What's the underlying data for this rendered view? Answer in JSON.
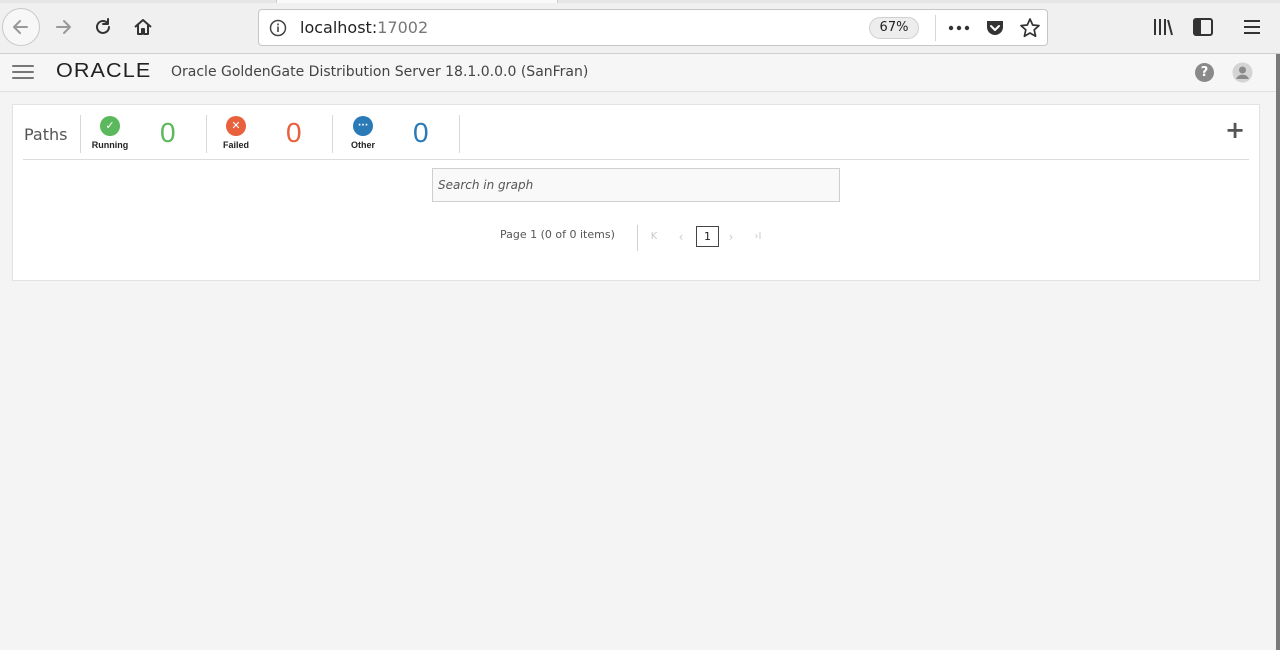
{
  "browser": {
    "url_host": "localhost:",
    "url_port": "17002",
    "zoom": "67%",
    "icons": {
      "back": "back-arrow-icon",
      "forward": "forward-arrow-icon",
      "reload": "reload-icon",
      "home": "home-icon",
      "info": "info-icon",
      "more": "more-actions-icon",
      "pocket": "pocket-icon",
      "star": "bookmark-star-icon",
      "library": "library-icon",
      "sidebar": "sidebar-icon",
      "menu": "menu-icon"
    }
  },
  "header": {
    "logo": "ORACLE",
    "title": "Oracle GoldenGate Distribution Server 18.1.0.0.0 (SanFran)",
    "help_glyph": "?"
  },
  "paths": {
    "label": "Paths",
    "statuses": [
      {
        "label": "Running",
        "count": "0",
        "color": "#5cb85c",
        "glyph": "✓"
      },
      {
        "label": "Failed",
        "count": "0",
        "color": "#e8603c",
        "glyph": "✕"
      },
      {
        "label": "Other",
        "count": "0",
        "color": "#2a7ab8",
        "glyph": "···"
      }
    ],
    "add_glyph": "+"
  },
  "search": {
    "placeholder": "Search in graph"
  },
  "pager": {
    "text": "Page  1  (0 of 0 items)",
    "current_page": "1",
    "first_glyph": "K",
    "prev_glyph": "‹",
    "next_glyph": "›",
    "last_glyph": "›I"
  }
}
